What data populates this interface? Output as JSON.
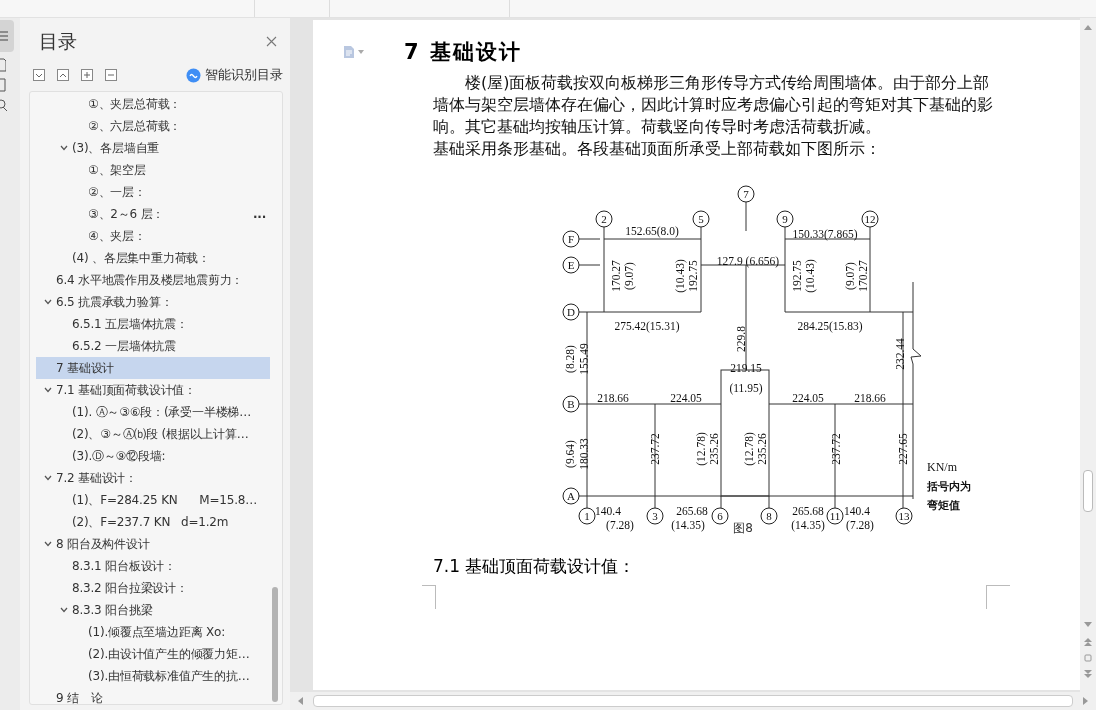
{
  "sidebar": {
    "title": "目录",
    "smart_toc": "智能识别目录",
    "toc": [
      {
        "children": [
          {
            "children": [
              {
                "label": "①、夹层总荷载：",
                "selected": false
              },
              {
                "label": "②、六层总荷载：",
                "selected": false
              }
            ]
          },
          {
            "label": "(3)、各层墙自重",
            "selected": false,
            "expanded": true,
            "children": [
              {
                "label": "①、架空层",
                "selected": false
              },
              {
                "label": "②、一层：",
                "selected": false
              },
              {
                "label": "③、2～6 层：",
                "selected": false,
                "suffix": "..."
              },
              {
                "label": "④、夹层：",
                "selected": false
              }
            ]
          },
          {
            "label": "(4) 、各层集中重力荷载：",
            "selected": false
          }
        ]
      },
      {
        "label": "6.4 水平地震作用及楼层地震剪力：",
        "selected": false
      },
      {
        "label": "6.5 抗震承载力验算：",
        "selected": false,
        "expanded": true,
        "children": [
          {
            "label": "6.5.1 五层墙体抗震：",
            "selected": false
          },
          {
            "label": "6.5.2 一层墙体抗震",
            "selected": false
          }
        ]
      },
      {
        "label": "7 基础设计",
        "selected": true
      },
      {
        "label": "7.1 基础顶面荷载设计值：",
        "selected": false,
        "expanded": true,
        "children": [
          {
            "label": "(1). Ⓐ～③⑥段：(承受一半楼梯…",
            "selected": false
          },
          {
            "label": "(2)、③～Ⓐ⒝段 (根据以上计算…",
            "selected": false
          },
          {
            "label": "(3).Ⓓ～⑨⑫段墙:",
            "selected": false
          }
        ]
      },
      {
        "label": "7.2 基础设计：",
        "selected": false,
        "expanded": true,
        "children": [
          {
            "label": "(1)、F=284.25 KN      M=15.8…",
            "selected": false
          },
          {
            "label": "(2)、F=237.7 KN   d=1.2m",
            "selected": false
          }
        ]
      },
      {
        "label": "8 阳台及构件设计",
        "selected": false,
        "expanded": true,
        "children": [
          {
            "label": "8.3.1 阳台板设计：",
            "selected": false
          },
          {
            "label": "8.3.2 阳台拉梁设计：",
            "selected": false
          },
          {
            "label": "8.3.3 阳台挑梁",
            "selected": false,
            "expanded": true,
            "children": [
              {
                "label": "(1).倾覆点至墙边距离 Xo:",
                "selected": false
              },
              {
                "label": "(2).由设计值产生的倾覆力矩…",
                "selected": false
              },
              {
                "label": "(3).由恒荷载标准值产生的抗…",
                "selected": false
              }
            ]
          }
        ]
      },
      {
        "label": "9 结　论",
        "selected": false
      }
    ]
  },
  "document": {
    "heading": "7 基础设计",
    "paragraphs": [
      "楼(屋)面板荷载按双向板梯形三角形传导方式传给周围墙体。由于部分上部墙体与架空层墙体存在偏心，因此计算时应考虑偏心引起的弯矩对其下基础的影响。其它基础均按轴压计算。荷载竖向传导时考虑活荷载折减。",
      "基础采用条形基础。各段基础顶面所承受上部荷载如下图所示："
    ],
    "figure": {
      "axis_labels": [
        "F",
        "E",
        "D",
        "B",
        "A"
      ],
      "top_grid_numbers": [
        "2",
        "5",
        "7",
        "9",
        "12"
      ],
      "bottom_grid_numbers": [
        "1",
        "3",
        "6",
        "8",
        "11",
        "13"
      ],
      "load_labels": [
        "152.65(8.0)",
        "150.33(7.865)",
        "127.9 (6.656)",
        "275.42(15.31)",
        "284.25(15.83)",
        "219.15",
        "(11.95)",
        "218.66",
        "224.05",
        "224.05",
        "218.66",
        "140.4",
        "(7.28)",
        "265.68",
        "(14.35)",
        "265.68",
        "(14.35)",
        "140.4",
        "(7.28)",
        "170.27",
        "(9.07)",
        "(10.43)",
        "192.75",
        "192.75",
        "(10.43)",
        "(9.07)",
        "170.27",
        "229.8",
        "(8.28)",
        "155.49",
        "232.44",
        "(9.64)",
        "180.33",
        "237.72",
        "(12.78)",
        "235.26",
        "(12.78)",
        "235.26",
        "237.72",
        "227.65"
      ],
      "legend": [
        "KN/m",
        "括号内为",
        "弯矩值"
      ],
      "caption": "图8"
    },
    "subheading": "7.1 基础顶面荷载设计值："
  }
}
